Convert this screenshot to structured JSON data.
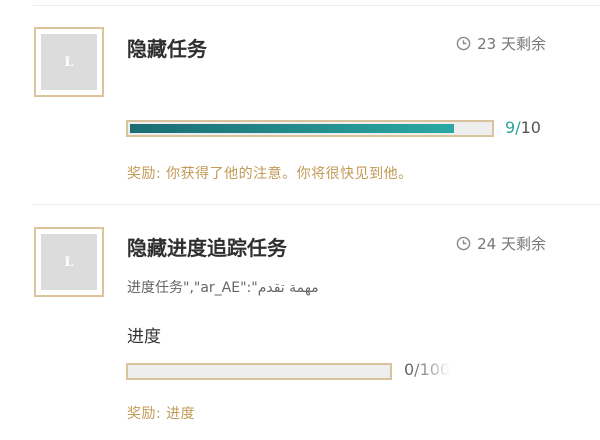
{
  "colors": {
    "accent_teal": "#2aa39e",
    "bar_fill_dark": "#1b6d72",
    "gold_border": "#dcc39b",
    "reward_text": "#c29a58"
  },
  "quests": [
    {
      "thumb_letter": "L",
      "title": "隐藏任务",
      "time_icon": "clock-icon",
      "time_left": "23 天剩余",
      "progress_current": "9",
      "progress_separator": "/",
      "progress_total": "10",
      "progress_fraction": 0.9,
      "reward": "奖励: 你获得了他的注意。你将很快见到他。"
    },
    {
      "thumb_letter": "L",
      "title": "隐藏进度追踪任务",
      "time_icon": "clock-icon",
      "time_left": "24 天剩余",
      "description": "进度任务\",\"ar_AE\":\"مهمة تقدم",
      "progress_label": "进度",
      "progress_text": "0/100",
      "progress_fraction": 0,
      "reward": "奖励: 进度"
    }
  ]
}
